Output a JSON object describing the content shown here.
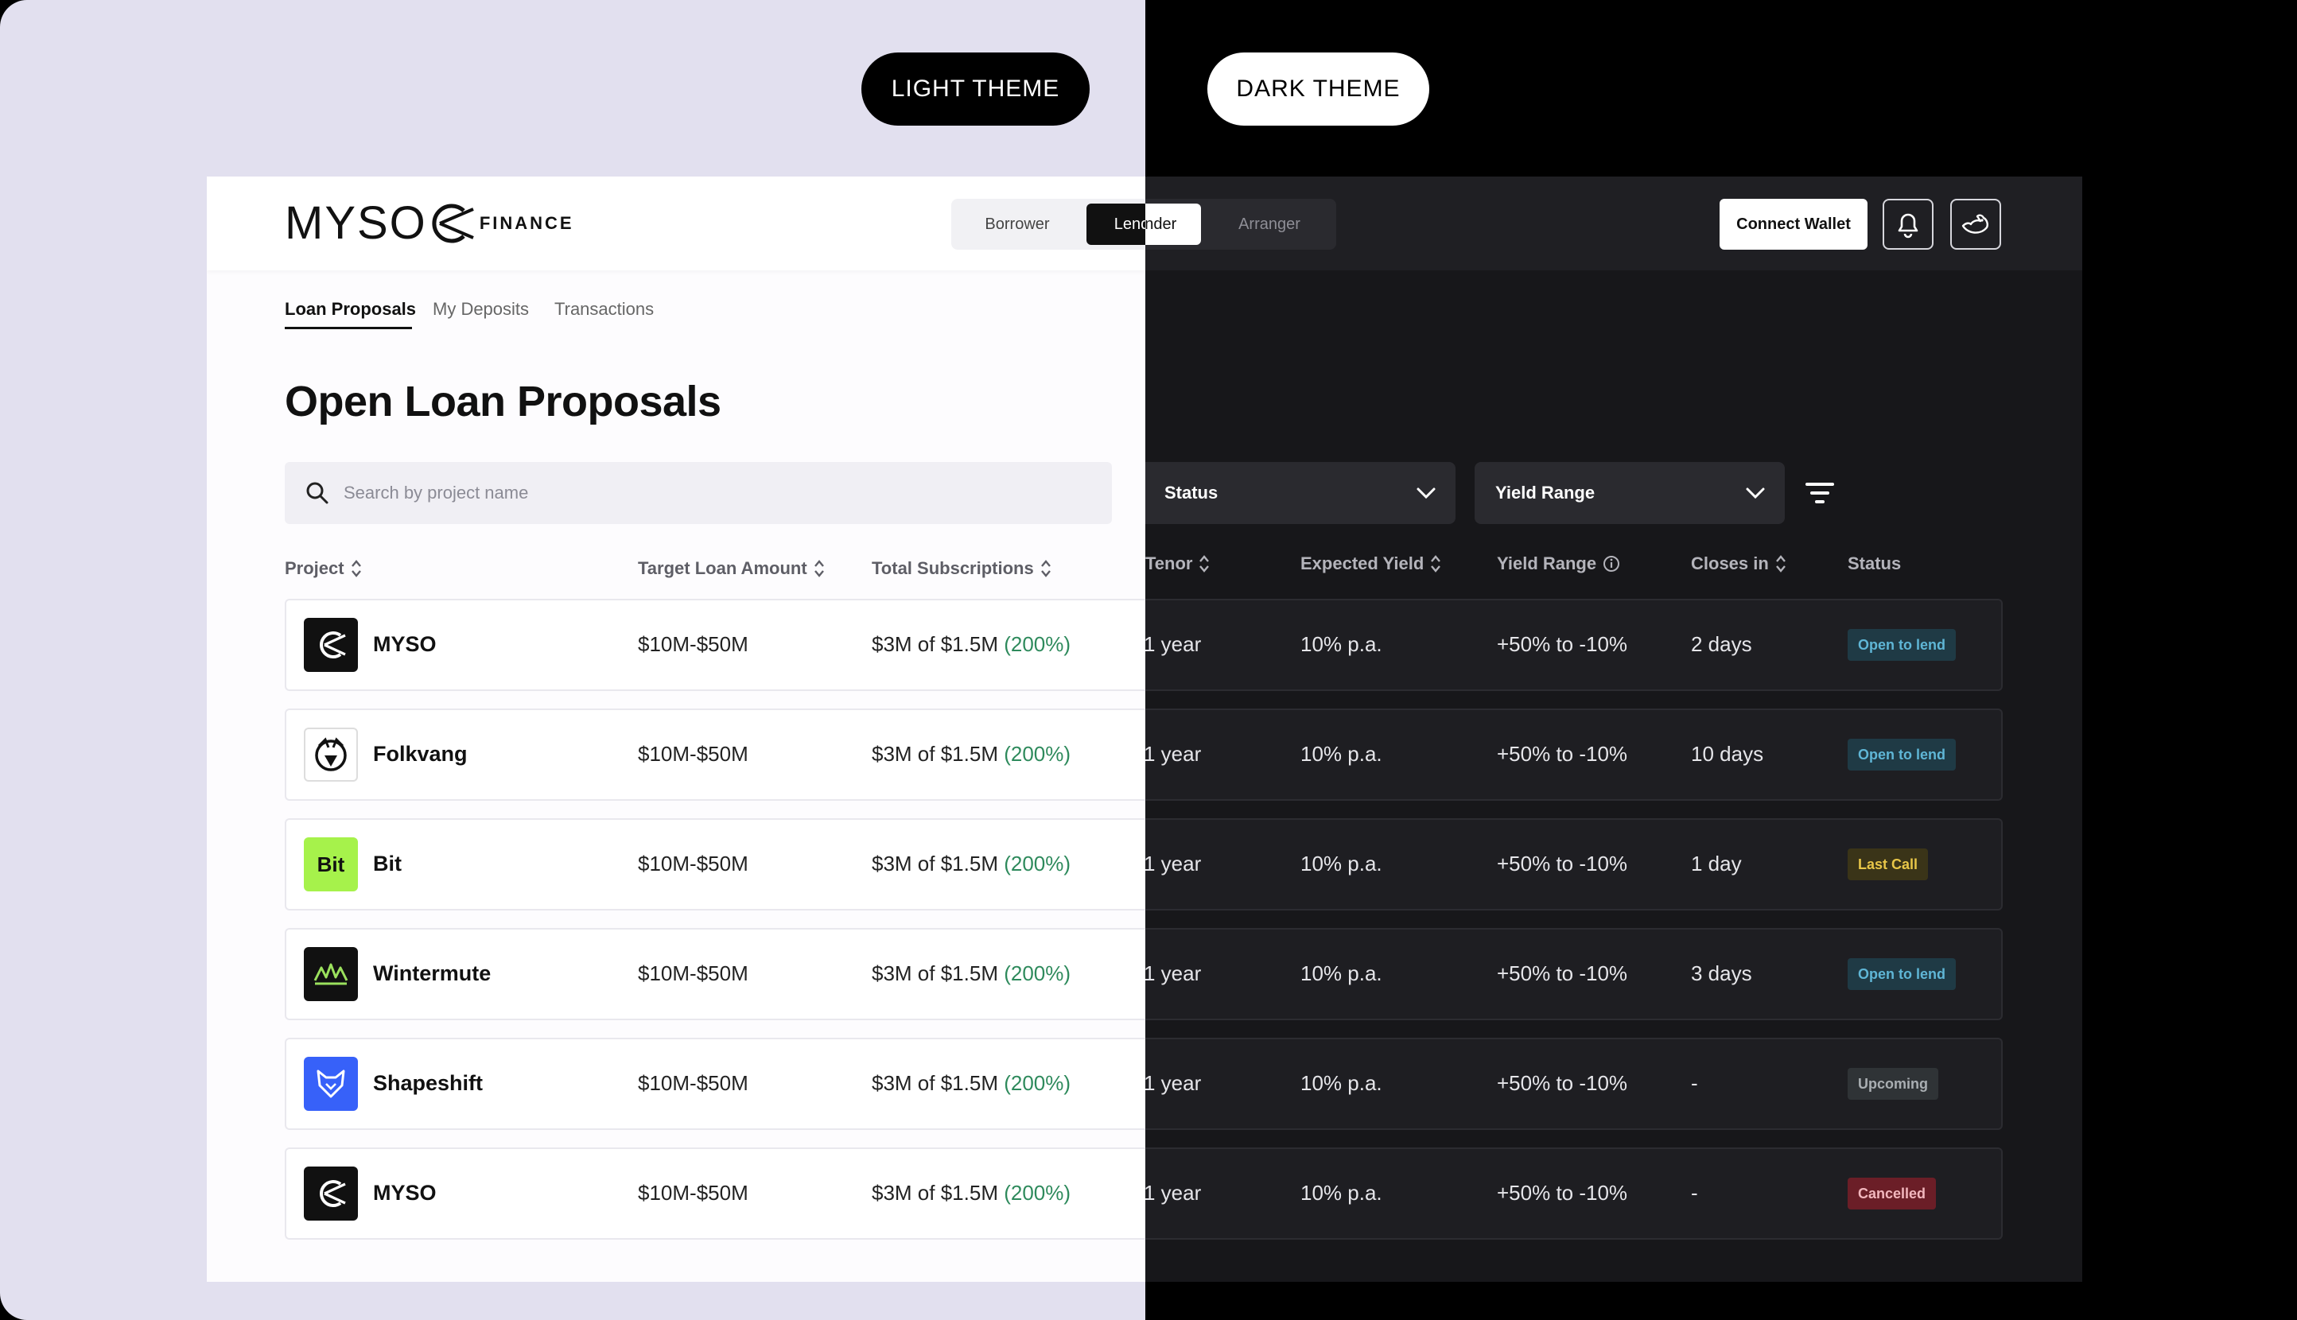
{
  "theme_labels": {
    "light": "LIGHT THEME",
    "dark": "DARK THEME"
  },
  "logo": {
    "word": "MYSO",
    "suffix": "FINANCE"
  },
  "roles": {
    "borrower": "Borrower",
    "lender": "Lender",
    "arranger": "Arranger",
    "selected": "Lender"
  },
  "header_actions": {
    "connect_wallet": "Connect Wallet"
  },
  "tabs": {
    "loan_proposals": "Loan Proposals",
    "my_deposits": "My Deposits",
    "transactions": "Transactions",
    "active": "Loan Proposals"
  },
  "page_title": "Open Loan Proposals",
  "search": {
    "placeholder": "Search by project name"
  },
  "filters": {
    "status": "Status",
    "yield_range": "Yield Range"
  },
  "columns": {
    "project": "Project",
    "target_loan_amount": "Target Loan Amount",
    "total_subscriptions": "Total Subscriptions",
    "tenor": "Tenor",
    "expected_yield": "Expected Yield",
    "yield_range": "Yield Range",
    "closes_in": "Closes in",
    "status": "Status"
  },
  "rows": [
    {
      "project": "MYSO",
      "logo_text": "",
      "target": "$10M-$50M",
      "subs": "$3M of $1.5M ",
      "subs_pct": "(200%)",
      "tenor": "1 year",
      "yield": "10% p.a.",
      "yield_range": "+50% to -10%",
      "closes_in": "2 days",
      "status": "Open to lend"
    },
    {
      "project": "Folkvang",
      "logo_text": "",
      "target": "$10M-$50M",
      "subs": "$3M of $1.5M ",
      "subs_pct": "(200%)",
      "tenor": "1 year",
      "yield": "10% p.a.",
      "yield_range": "+50% to -10%",
      "closes_in": "10 days",
      "status": "Open to lend"
    },
    {
      "project": "Bit",
      "logo_text": "Bit",
      "target": "$10M-$50M",
      "subs": "$3M of $1.5M ",
      "subs_pct": "(200%)",
      "tenor": "1 year",
      "yield": "10% p.a.",
      "yield_range": "+50% to -10%",
      "closes_in": "1 day",
      "status": "Last Call"
    },
    {
      "project": "Wintermute",
      "logo_text": "",
      "target": "$10M-$50M",
      "subs": "$3M of $1.5M ",
      "subs_pct": "(200%)",
      "tenor": "1 year",
      "yield": "10% p.a.",
      "yield_range": "+50% to -10%",
      "closes_in": "3 days",
      "status": "Open to lend"
    },
    {
      "project": "Shapeshift",
      "logo_text": "",
      "target": "$10M-$50M",
      "subs": "$3M of $1.5M ",
      "subs_pct": "(200%)",
      "tenor": "1 year",
      "yield": "10% p.a.",
      "yield_range": "+50% to -10%",
      "closes_in": "-",
      "status": "Upcoming"
    },
    {
      "project": "MYSO",
      "logo_text": "",
      "target": "$10M-$50M",
      "subs": "$3M of $1.5M ",
      "subs_pct": "(200%)",
      "tenor": "1 year",
      "yield": "10% p.a.",
      "yield_range": "+50% to -10%",
      "closes_in": "-",
      "status": "Cancelled"
    }
  ],
  "colors": {
    "light_bg": "#e2e0ef",
    "dark_bg": "#000000",
    "accent_green": "#2e8a5c",
    "badge_open": "#5fb6d6",
    "badge_last_call": "#e8c648",
    "badge_cancelled": "#6b1e27",
    "bit_logo": "#a6f24b",
    "shapeshift_logo": "#3761f9"
  }
}
